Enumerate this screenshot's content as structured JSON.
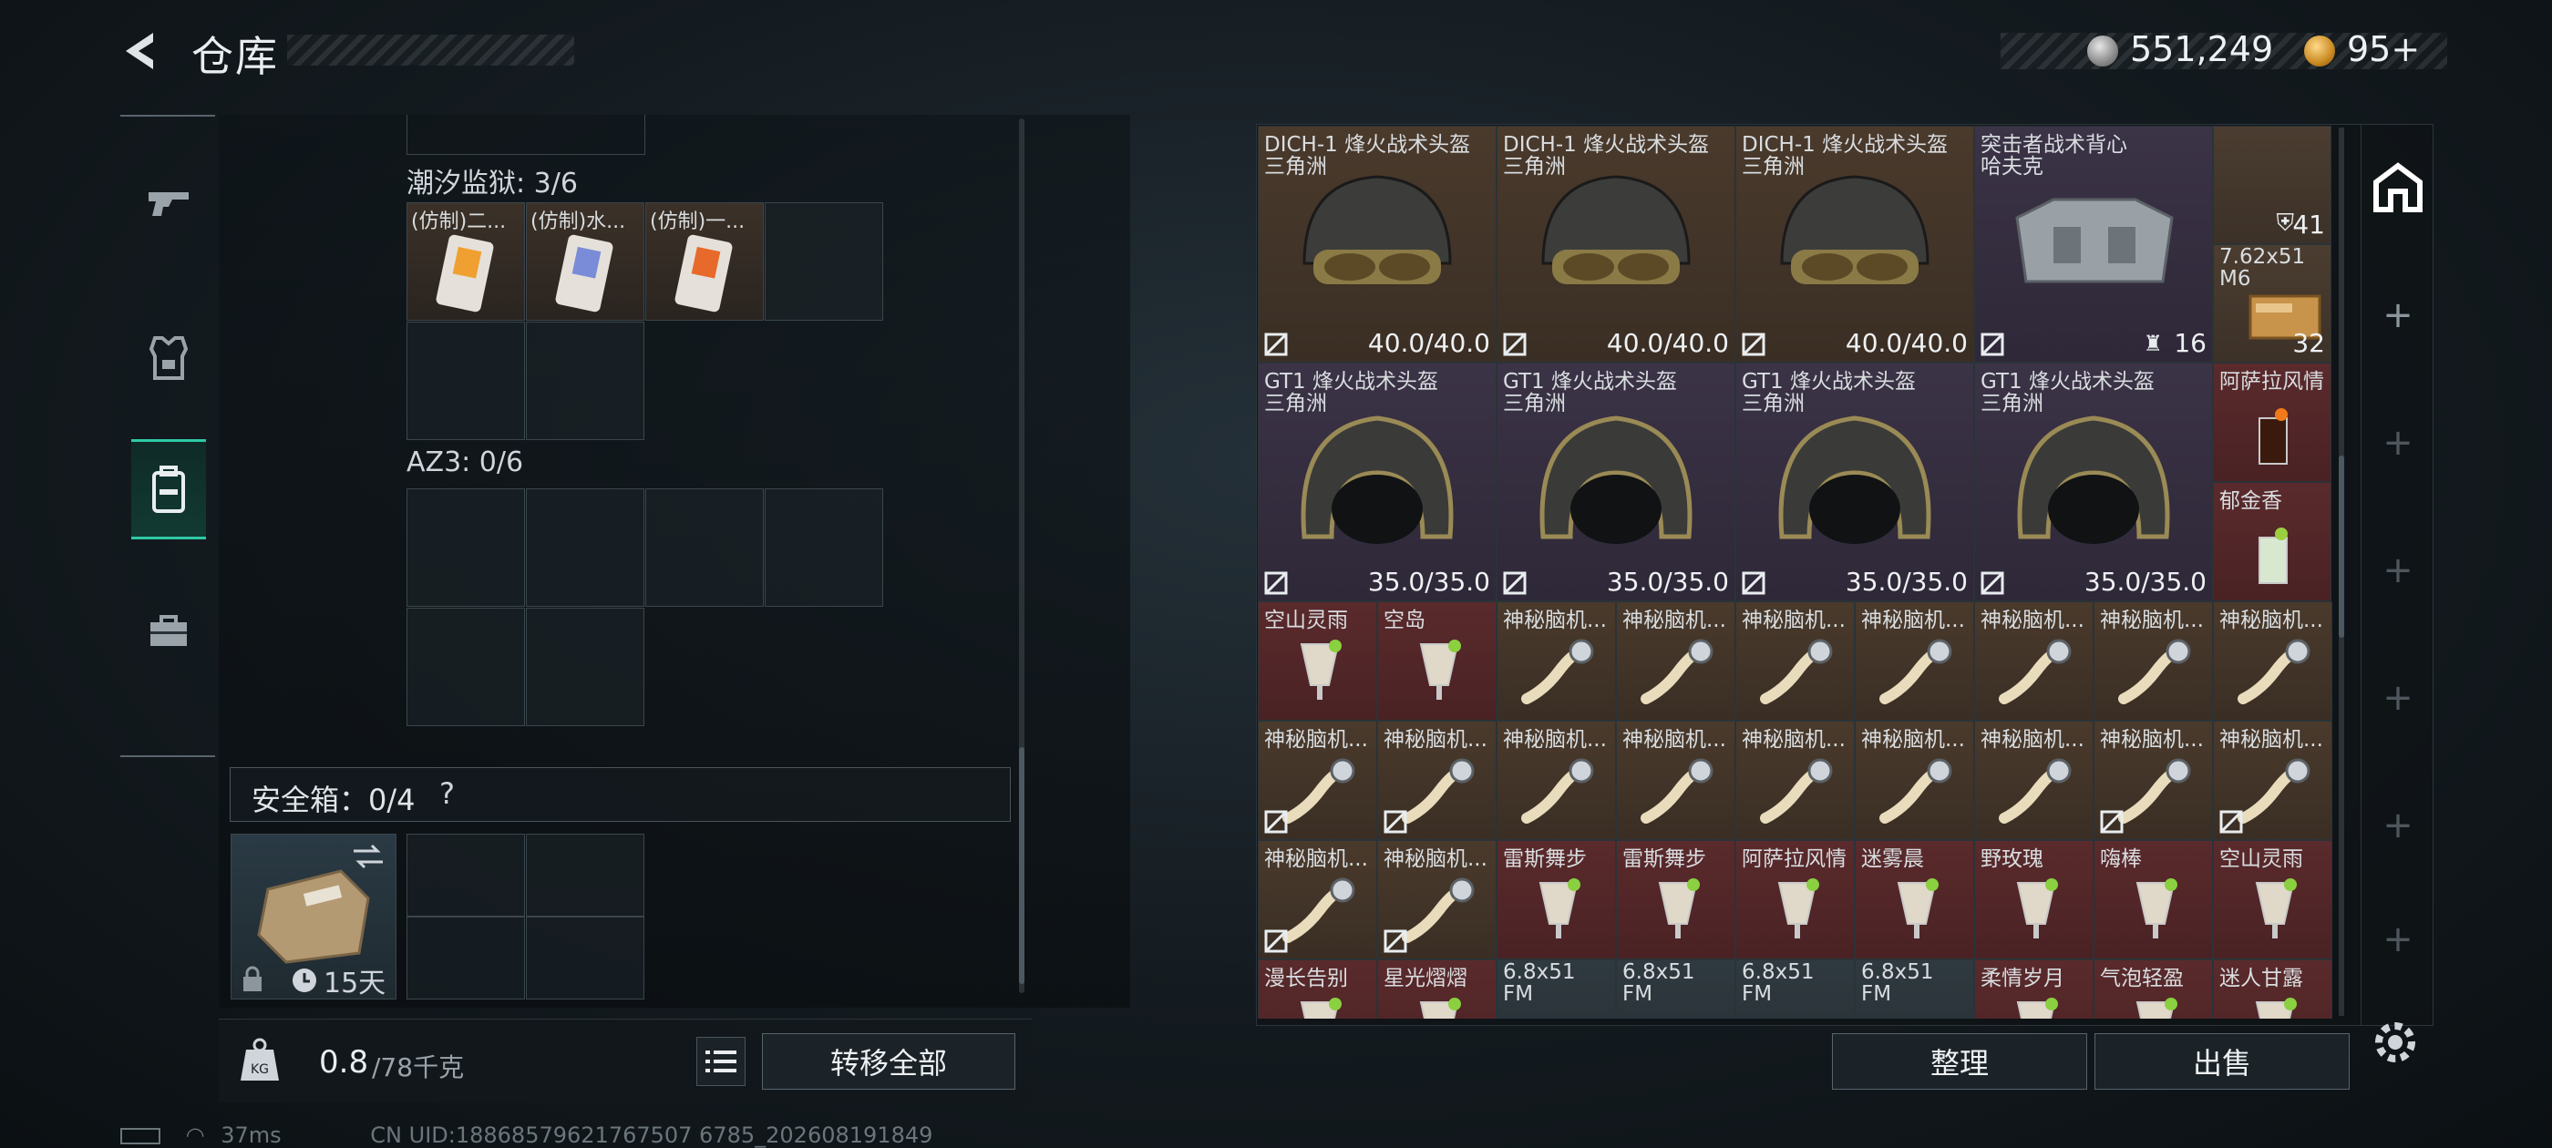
{
  "header": {
    "title": "仓库",
    "money_silver": "551,249",
    "money_gold": "95+"
  },
  "nav": {
    "items": [
      "weapon-icon",
      "armor-icon",
      "backpack-icon",
      "toolbox-icon"
    ],
    "active": 2
  },
  "left": {
    "section1_label": "潮汐监狱: 3/6",
    "section1_items": [
      "(仿制)二...",
      "(仿制)水...",
      "(仿制)一..."
    ],
    "section2_label": "AZ3: 0/6",
    "safebox_label": "安全箱：0/4",
    "safebox_help": "?",
    "safebox_days": "15天",
    "weight_value": "0.8",
    "weight_max": "/78千克",
    "transfer_all": "转移全部"
  },
  "stash": {
    "row1": [
      {
        "n1": "DICH-1 烽火战术头盔",
        "n2": "三角洲",
        "dur": "40.0/40.0"
      },
      {
        "n1": "DICH-1 烽火战术头盔",
        "n2": "三角洲",
        "dur": "40.0/40.0"
      },
      {
        "n1": "DICH-1 烽火战术头盔",
        "n2": "三角洲",
        "dur": "40.0/40.0"
      },
      {
        "n1": "突击者战术背心",
        "n2": "哈夫克",
        "cnt": "16"
      }
    ],
    "armor_count": "41",
    "ammo": {
      "n1": "7.62x51",
      "n2": "M6",
      "cnt": "32"
    },
    "row2": [
      {
        "n1": "GT1 烽火战术头盔",
        "n2": "三角洲",
        "dur": "35.0/35.0"
      },
      {
        "n1": "GT1 烽火战术头盔",
        "n2": "三角洲",
        "dur": "35.0/35.0"
      },
      {
        "n1": "GT1 烽火战术头盔",
        "n2": "三角洲",
        "dur": "35.0/35.0"
      },
      {
        "n1": "GT1 烽火战术头盔",
        "n2": "三角洲",
        "dur": "35.0/35.0"
      }
    ],
    "drink_a": "阿萨拉风情",
    "drink_b": "郁金香",
    "row3": [
      "空山灵雨",
      "空岛",
      "神秘脑机...",
      "神秘脑机...",
      "神秘脑机...",
      "神秘脑机...",
      "神秘脑机...",
      "神秘脑机...",
      "神秘脑机..."
    ],
    "row4": [
      "神秘脑机...",
      "神秘脑机...",
      "神秘脑机...",
      "神秘脑机...",
      "神秘脑机...",
      "神秘脑机...",
      "神秘脑机...",
      "神秘脑机...",
      "神秘脑机..."
    ],
    "row5": [
      "神秘脑机...",
      "神秘脑机...",
      "雷斯舞步",
      "雷斯舞步",
      "阿萨拉风情",
      "迷雾晨",
      "野玫瑰",
      "嗨棒",
      "空山灵雨"
    ],
    "row6": [
      "漫长告别",
      "星光熠熠",
      "6.8x51",
      "6.8x51",
      "6.8x51",
      "6.8x51",
      "柔情岁月",
      "气泡轻盈",
      "迷人甘露"
    ],
    "row6_sub": "FM",
    "sort": "整理",
    "sell": "出售"
  },
  "status": {
    "ping": "37ms",
    "uid": "CN UID:18868579621767507 6785_202608191849"
  },
  "colors": {
    "accent": "#2ec9a5",
    "brown": "#4a3a2c",
    "purple": "#3b3346",
    "red": "#5a2a2c"
  }
}
